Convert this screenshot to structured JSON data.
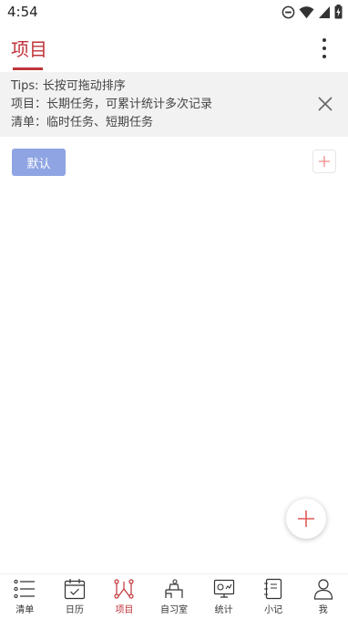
{
  "status_bar": {
    "time": "4:54",
    "icons": [
      "do-not-disturb-icon",
      "wifi-icon",
      "signal-icon",
      "battery-charging-icon"
    ]
  },
  "header": {
    "title": "项目",
    "more_icon": "more-vertical-icon",
    "accent_color": "#c0343a"
  },
  "tips": {
    "lines": [
      "Tips: 长按可拖动排序",
      "项目：长期任务，可累计统计多次记录",
      "清单：临时任务、短期任务"
    ],
    "close_icon": "close-icon"
  },
  "categories": {
    "items": [
      {
        "label": "默认",
        "color": "#8fa4e3"
      }
    ],
    "add_icon": "plus-icon"
  },
  "fab": {
    "icon": "plus-icon"
  },
  "bottom_nav": {
    "items": [
      {
        "label": "清单",
        "icon": "list-icon",
        "active": false
      },
      {
        "label": "日历",
        "icon": "calendar-icon",
        "active": false
      },
      {
        "label": "项目",
        "icon": "project-icon",
        "active": true
      },
      {
        "label": "自习室",
        "icon": "study-room-icon",
        "active": false
      },
      {
        "label": "统计",
        "icon": "statistics-icon",
        "active": false
      },
      {
        "label": "小记",
        "icon": "notebook-icon",
        "active": false
      },
      {
        "label": "我",
        "icon": "profile-icon",
        "active": false
      }
    ]
  }
}
